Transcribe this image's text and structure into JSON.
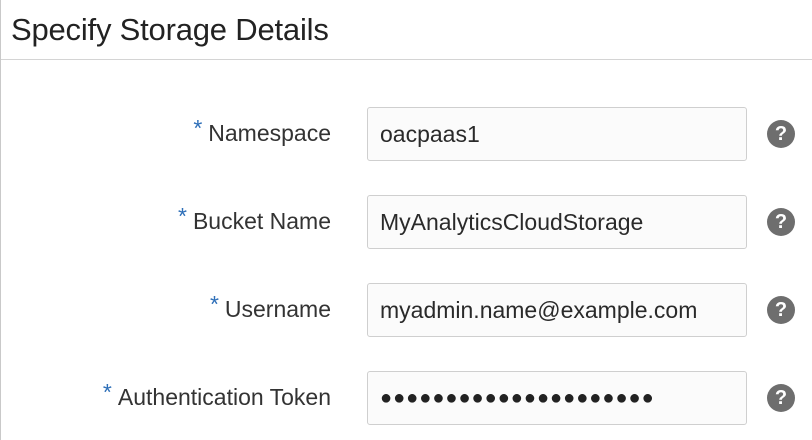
{
  "section": {
    "title": "Specify Storage Details"
  },
  "form": {
    "required_marker": "*",
    "help_glyph": "?",
    "fields": [
      {
        "label": "Namespace",
        "value": "oacpaas1",
        "type": "text"
      },
      {
        "label": "Bucket Name",
        "value": "MyAnalyticsCloudStorage",
        "type": "text"
      },
      {
        "label": "Username",
        "value": "myadmin.name@example.com",
        "type": "text"
      },
      {
        "label": "Authentication Token",
        "value": "●●●●●●●●●●●●●●●●●●●●●",
        "type": "password"
      }
    ]
  },
  "colors": {
    "required_marker": "#2e6fb8",
    "help_icon": "#6e6e6e",
    "field_border": "#cfcfcf",
    "text": "#333333"
  }
}
